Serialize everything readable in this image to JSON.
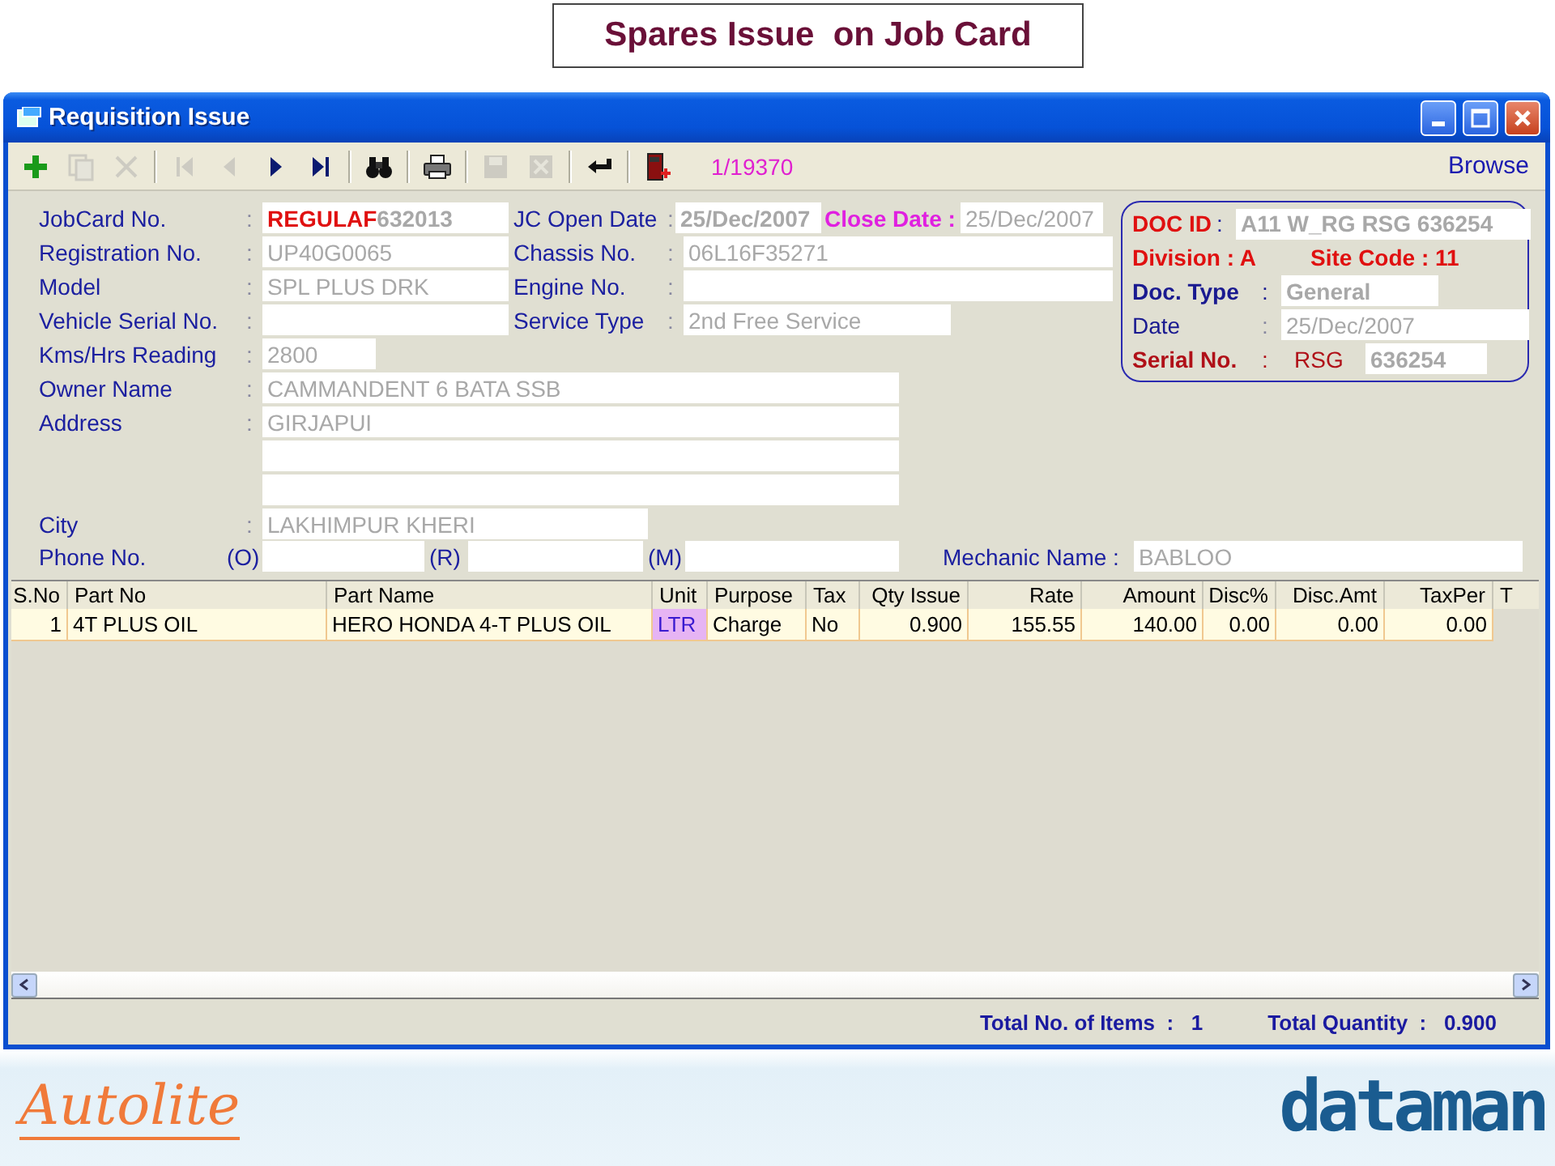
{
  "page_title": "Spares Issue  on Job Card",
  "window": {
    "title": "Requisition Issue"
  },
  "toolbar": {
    "buttons": [
      {
        "kind": "add",
        "disabled": false
      },
      {
        "kind": "copy",
        "disabled": true
      },
      {
        "kind": "delete",
        "disabled": true
      },
      {
        "kind": "first",
        "disabled": true
      },
      {
        "kind": "prev",
        "disabled": true
      },
      {
        "kind": "next",
        "disabled": false
      },
      {
        "kind": "last",
        "disabled": false
      },
      {
        "kind": "find",
        "disabled": false
      },
      {
        "kind": "print",
        "disabled": false
      },
      {
        "kind": "save",
        "disabled": true
      },
      {
        "kind": "cancel",
        "disabled": true
      },
      {
        "kind": "return",
        "disabled": false
      },
      {
        "kind": "exit",
        "disabled": false
      }
    ],
    "record": "1/19370",
    "mode": "Browse"
  },
  "form": {
    "jobcard_no": {
      "label": "JobCard No.",
      "sep": ":",
      "prefix": "REGULAF",
      "value": "632013"
    },
    "registration_no": {
      "label": "Registration No.",
      "sep": ":",
      "value": "UP40G0065"
    },
    "model": {
      "label": "Model",
      "sep": ":",
      "value": "SPL PLUS DRK"
    },
    "vehicle_serial_no": {
      "label": "Vehicle Serial No.",
      "sep": ":"
    },
    "kms_hrs_reading": {
      "label": "Kms/Hrs Reading",
      "sep": ":",
      "value": "2800"
    },
    "owner_name": {
      "label": "Owner Name",
      "sep": ":",
      "value": "CAMMANDENT 6 BATA SSB"
    },
    "address": {
      "label": "Address",
      "sep": ":",
      "lines": [
        "GIRJAPUI"
      ]
    },
    "city": {
      "label": "City",
      "sep": ":",
      "value": "LAKHIMPUR KHERI"
    },
    "jc_open_date": {
      "label": "JC Open Date",
      "sep": ":",
      "value": "25/Dec/2007"
    },
    "close_date": {
      "label": "Close Date :",
      "value": "25/Dec/2007"
    },
    "chassis_no": {
      "label": "Chassis No.",
      "sep": ":",
      "value": "06L16F35271"
    },
    "engine_no": {
      "label": "Engine No.",
      "sep": ":"
    },
    "service_type": {
      "label": "Service Type",
      "sep": ":",
      "value": "2nd Free Service"
    },
    "phone": {
      "label": "Phone No.",
      "office": "(O)",
      "residence": "(R)",
      "mobile": "(M)"
    },
    "mechanic_name": {
      "label": "Mechanic Name :",
      "value": "BABLOO"
    }
  },
  "doc": {
    "doc_id": {
      "label": "DOC ID",
      "sep": ":",
      "value": "A11 W_RG  RSG  636254"
    },
    "division": "Division : A",
    "site_code": "Site Code : 11",
    "doc_type": {
      "label": "Doc. Type",
      "sep": ":",
      "value": "General"
    },
    "date": {
      "label": "Date",
      "sep": ":",
      "value": "25/Dec/2007"
    },
    "serial_no": {
      "label": "Serial No.",
      "sep": ":",
      "prefix": "RSG",
      "value": "636254"
    }
  },
  "table": {
    "columns": [
      {
        "label": "S.No",
        "numeric": true
      },
      {
        "label": "Part No",
        "numeric": false
      },
      {
        "label": "Part Name",
        "numeric": false
      },
      {
        "label": "Unit",
        "numeric": false
      },
      {
        "label": "Purpose",
        "numeric": false
      },
      {
        "label": "Tax",
        "numeric": false
      },
      {
        "label": "Qty Issue",
        "numeric": true
      },
      {
        "label": "Rate",
        "numeric": true
      },
      {
        "label": "Amount",
        "numeric": true
      },
      {
        "label": "Disc%",
        "numeric": true
      },
      {
        "label": "Disc.Amt",
        "numeric": true
      },
      {
        "label": "TaxPer",
        "numeric": true
      },
      {
        "label": "T",
        "numeric": false
      }
    ],
    "rows": [
      {
        "cells": [
          {
            "text": "1",
            "selected": false
          },
          {
            "text": "4T PLUS OIL",
            "selected": false
          },
          {
            "text": "HERO HONDA 4-T PLUS OIL",
            "selected": false
          },
          {
            "text": "LTR",
            "selected": true
          },
          {
            "text": "Charge",
            "selected": false
          },
          {
            "text": "No",
            "selected": false
          },
          {
            "text": "0.900",
            "selected": false
          },
          {
            "text": "155.55",
            "selected": false
          },
          {
            "text": "140.00",
            "selected": false
          },
          {
            "text": "0.00",
            "selected": false
          },
          {
            "text": "0.00",
            "selected": false
          },
          {
            "text": "0.00",
            "selected": false
          }
        ]
      }
    ]
  },
  "status_bar": {
    "totals": [
      {
        "label": "Total No. of Items",
        "sep": ":",
        "value": "1"
      },
      {
        "label": "Total Quantity",
        "sep": ":",
        "value": "0.900"
      }
    ]
  },
  "footer": {
    "left_logo": "Autolite",
    "right_logo": "dataman"
  }
}
